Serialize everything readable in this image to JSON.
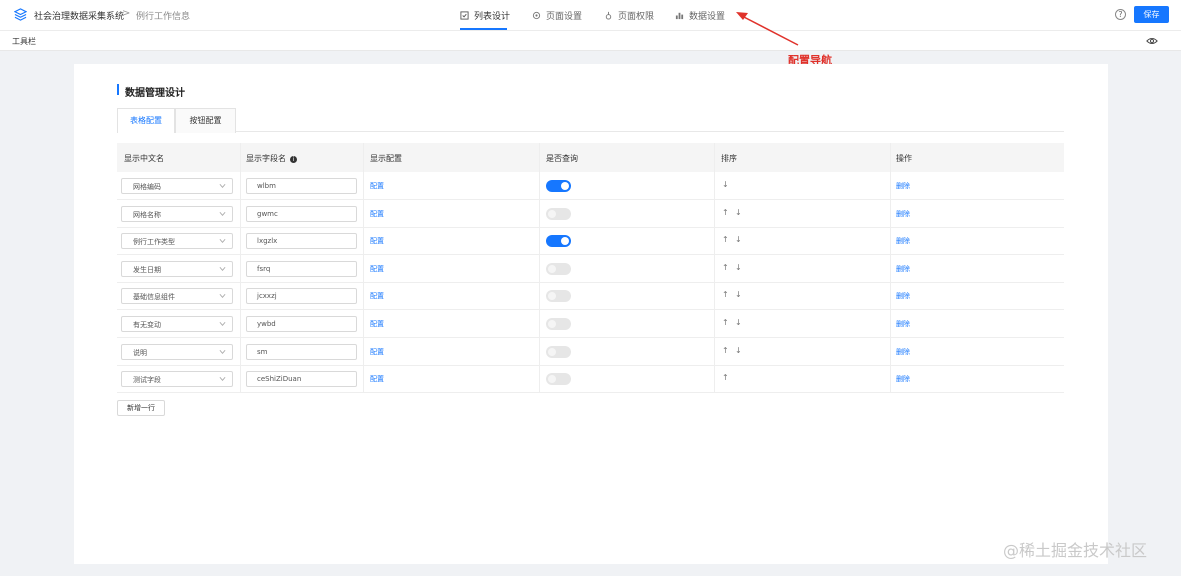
{
  "header": {
    "brand": "社会治理数据采集系统",
    "breadcrumb_sep": ">",
    "breadcrumb_current": "例行工作信息",
    "nav": [
      {
        "label": "列表设计",
        "icon": "list-design-icon",
        "active": true
      },
      {
        "label": "页面设置",
        "icon": "page-settings-icon",
        "active": false
      },
      {
        "label": "页面权限",
        "icon": "page-permission-icon",
        "active": false
      },
      {
        "label": "数据设置",
        "icon": "bar-chart-icon",
        "active": false
      }
    ],
    "help": "?",
    "save_label": "保存"
  },
  "toolbar": {
    "label": "工具栏"
  },
  "annotation": {
    "text": "配置导航",
    "color": "#e0322b"
  },
  "section": {
    "title": "数据管理设计"
  },
  "tabs": [
    {
      "label": "表格配置",
      "active": true
    },
    {
      "label": "按钮配置",
      "active": false
    }
  ],
  "table": {
    "headers": [
      "显示中文名",
      "显示字段名",
      "显示配置",
      "是否查询",
      "排序",
      "操作"
    ],
    "header_info": "i",
    "rows": [
      {
        "cn": "网格编码",
        "field": "wlbm",
        "config": "配置",
        "query": true,
        "up": false,
        "down": true,
        "action": "删除"
      },
      {
        "cn": "网格名称",
        "field": "gwmc",
        "config": "配置",
        "query": false,
        "up": true,
        "down": true,
        "action": "删除"
      },
      {
        "cn": "例行工作类型",
        "field": "lxgzlx",
        "config": "配置",
        "query": true,
        "up": true,
        "down": true,
        "action": "删除"
      },
      {
        "cn": "发生日期",
        "field": "fsrq",
        "config": "配置",
        "query": false,
        "up": true,
        "down": true,
        "action": "删除"
      },
      {
        "cn": "基础信息组件",
        "field": "jcxxzj",
        "config": "配置",
        "query": false,
        "up": true,
        "down": true,
        "action": "删除"
      },
      {
        "cn": "有无变动",
        "field": "ywbd",
        "config": "配置",
        "query": false,
        "up": true,
        "down": true,
        "action": "删除"
      },
      {
        "cn": "说明",
        "field": "sm",
        "config": "配置",
        "query": false,
        "up": true,
        "down": true,
        "action": "删除"
      },
      {
        "cn": "测试字段",
        "field": "ceShiZiDuan",
        "config": "配置",
        "query": false,
        "up": true,
        "down": false,
        "action": "删除"
      }
    ],
    "up_glyph": "↑",
    "down_glyph": "↓"
  },
  "add_row_label": "新增一行",
  "watermark": "@稀土掘金技术社区",
  "colors": {
    "accent": "#1677ff",
    "annotation": "#e0322b",
    "page_bg": "#f0f2f5"
  }
}
